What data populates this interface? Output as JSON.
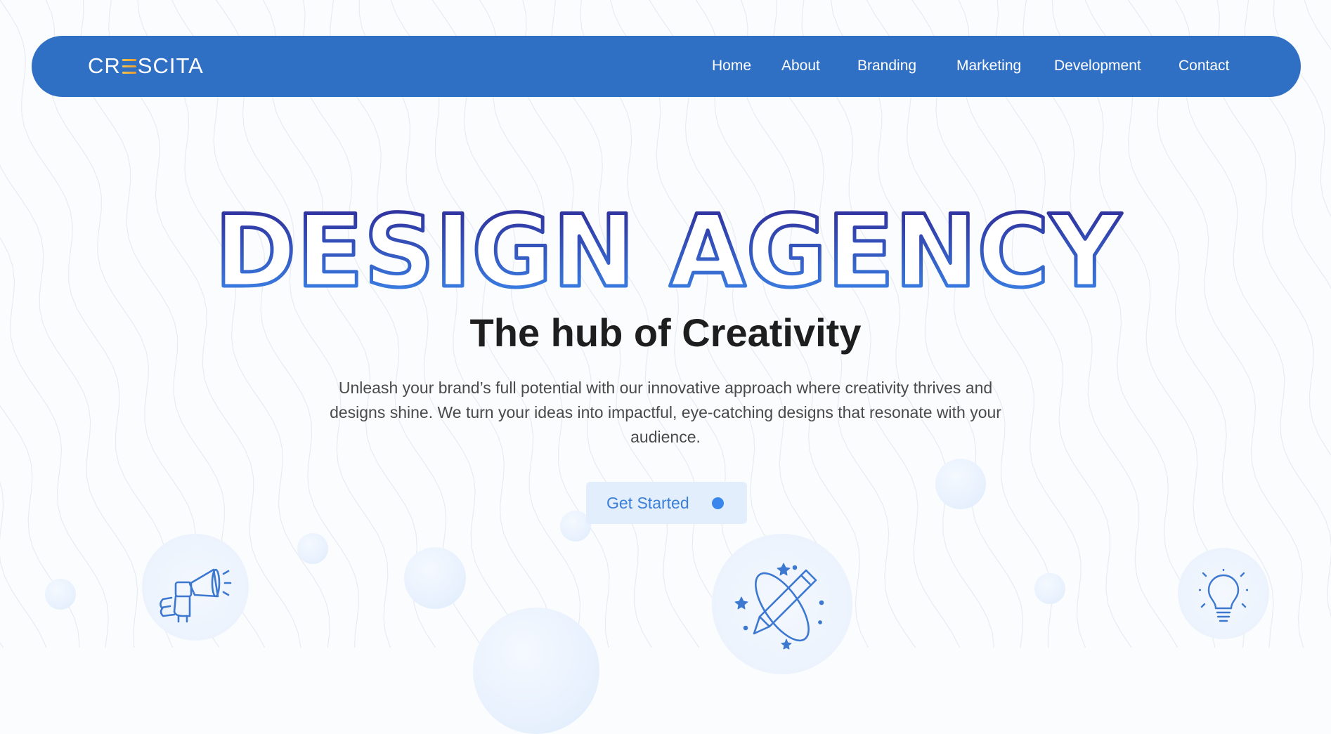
{
  "brand": {
    "logo_text_left": "CR",
    "logo_text_right": "SCITA"
  },
  "nav": {
    "items": [
      {
        "label": "Home"
      },
      {
        "label": "About"
      },
      {
        "label": "Branding"
      },
      {
        "label": "Marketing"
      },
      {
        "label": "Development"
      },
      {
        "label": "Contact"
      }
    ]
  },
  "hero": {
    "heading": "DESIGN AGENCY",
    "subtitle": "The hub of Creativity",
    "description": "Unleash your brand’s full potential with our innovative approach where creativity thrives and designs shine. We turn your ideas into impactful, eye-catching designs that resonate with your audience.",
    "cta_label": "Get Started"
  },
  "icons": [
    "megaphone-icon",
    "pencil-orbit-icon",
    "lightbulb-icon"
  ],
  "colors": {
    "navbar": "#2f6fc4",
    "heading_gradient_top": "#2e2390",
    "heading_gradient_bottom": "#3c8ef0",
    "cta_background": "#e2eefc",
    "cta_text": "#3b7fd8",
    "icon_stroke": "#3d78d0"
  }
}
